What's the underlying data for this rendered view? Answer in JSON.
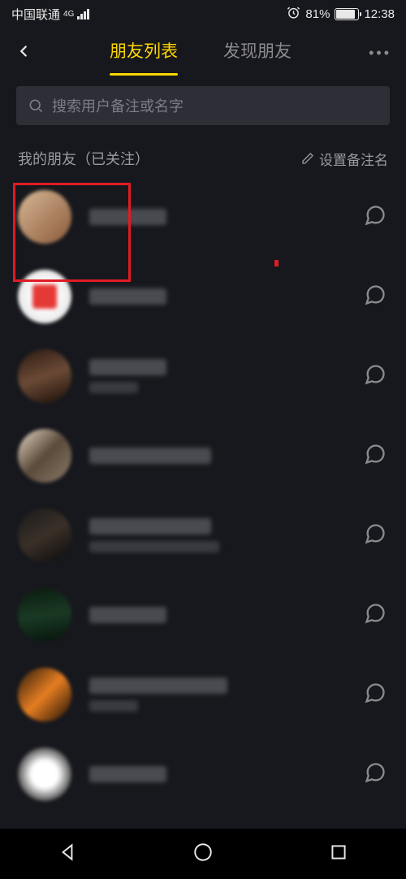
{
  "status": {
    "carrier": "中国联通",
    "network": "4G",
    "battery_pct": "81%",
    "time": "12:38"
  },
  "header": {
    "tab_active": "朋友列表",
    "tab_other": "发现朋友"
  },
  "search": {
    "placeholder": "搜索用户备注或名字"
  },
  "section": {
    "title": "我的朋友（已关注）",
    "edit_label": "设置备注名"
  },
  "friends": [
    {
      "avatar_bg": "linear-gradient(135deg,#d8b896,#8a5a3a)"
    },
    {
      "avatar_bg": "radial-gradient(circle,#ffffff 30%,#e8e8e8 70%)",
      "overlay": "#e53935"
    },
    {
      "avatar_bg": "linear-gradient(160deg,#2b1a12,#6b4a36,#1a0e08)"
    },
    {
      "avatar_bg": "linear-gradient(135deg,#e8d8c8,#5a4a3a,#8a7a6a)"
    },
    {
      "avatar_bg": "linear-gradient(150deg,#1a1a1a,#3a3028,#0a0a0a)"
    },
    {
      "avatar_bg": "linear-gradient(170deg,#0a1a0e,#1a3a24,#05120a)"
    },
    {
      "avatar_bg": "linear-gradient(135deg,#2a1a0a,#e67e22,#1a0e04)"
    },
    {
      "avatar_bg": "radial-gradient(circle,#ffffff 35%,#2a2a2a 80%)"
    }
  ]
}
